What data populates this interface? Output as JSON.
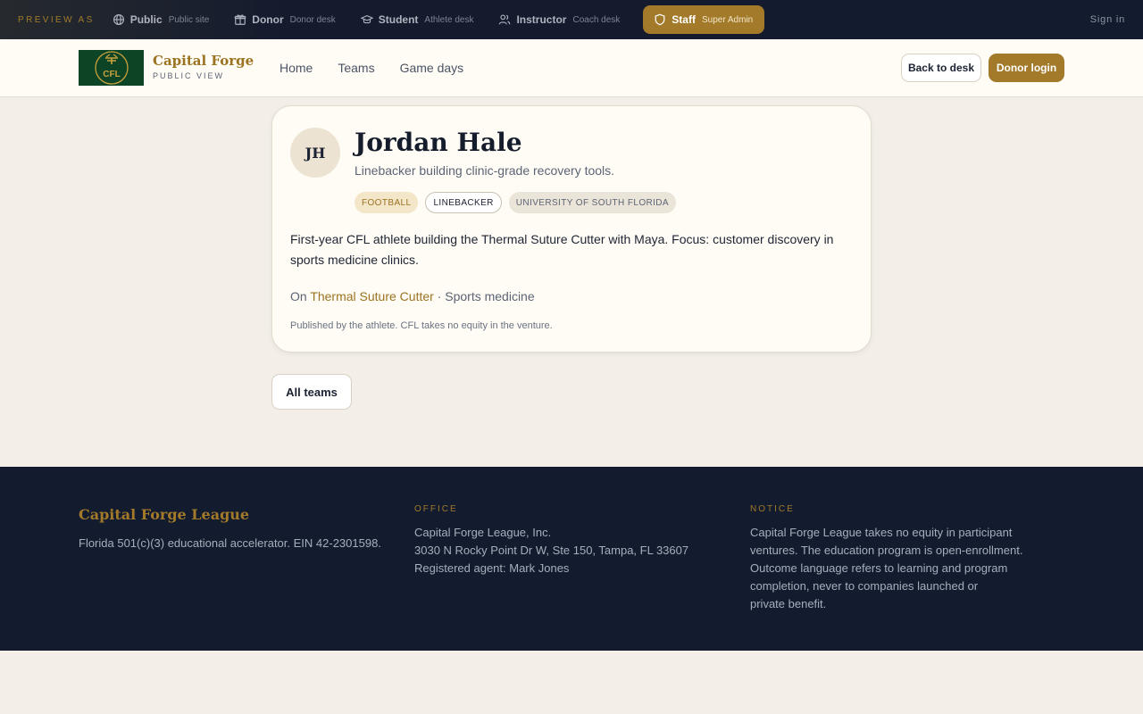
{
  "preview": {
    "label": "PREVIEW AS",
    "roles": [
      {
        "name": "Public",
        "desc": "Public site",
        "icon": "globe-icon"
      },
      {
        "name": "Donor",
        "desc": "Donor desk",
        "icon": "gift-icon"
      },
      {
        "name": "Student",
        "desc": "Athlete desk",
        "icon": "graduation-cap-icon"
      },
      {
        "name": "Instructor",
        "desc": "Coach desk",
        "icon": "users-icon"
      },
      {
        "name": "Staff",
        "desc": "Super Admin",
        "icon": "shield-icon",
        "active": true
      }
    ],
    "sign_in": "Sign in"
  },
  "header": {
    "logo_text": "CFL",
    "brand_name": "Capital Forge",
    "brand_sub": "PUBLIC VIEW",
    "nav": [
      "Home",
      "Teams",
      "Game days"
    ],
    "back_label": "Back to desk",
    "donor_label": "Donor login"
  },
  "profile": {
    "initials": "JH",
    "name": "Jordan Hale",
    "tagline": "Linebacker building clinic-grade recovery tools.",
    "chips": {
      "sport": "FOOTBALL",
      "position": "LINEBACKER",
      "school": "UNIVERSITY OF SOUTH FLORIDA"
    },
    "bio": "First-year CFL athlete building the Thermal Suture Cutter with Maya. Focus: customer discovery in sports medicine clinics.",
    "venture_prefix": "On ",
    "venture_name": "Thermal Suture Cutter",
    "venture_suffix": " · Sports medicine",
    "disclaimer": "Published by the athlete. CFL takes no equity in the venture."
  },
  "all_teams_label": "All teams",
  "footer": {
    "brand": "Capital Forge League",
    "legal": "Florida 501(c)(3) educational accelerator. EIN 42-2301598.",
    "office_heading": "OFFICE",
    "office_lines": [
      "Capital Forge League, Inc.",
      "3030 N Rocky Point Dr W, Ste 150, Tampa, FL 33607",
      "Registered agent: Mark Jones"
    ],
    "notice_heading": "NOTICE",
    "notice_lines": [
      "Capital Forge League takes no equity in participant",
      "ventures. The education program is open-enrollment.",
      "Outcome language refers to learning and program",
      "completion, never to companies launched or",
      "private benefit."
    ]
  },
  "colors": {
    "gold": "#a27a2a",
    "navy": "#131b2e",
    "logo_green": "#0e4426",
    "cream": "#fffcf5"
  }
}
